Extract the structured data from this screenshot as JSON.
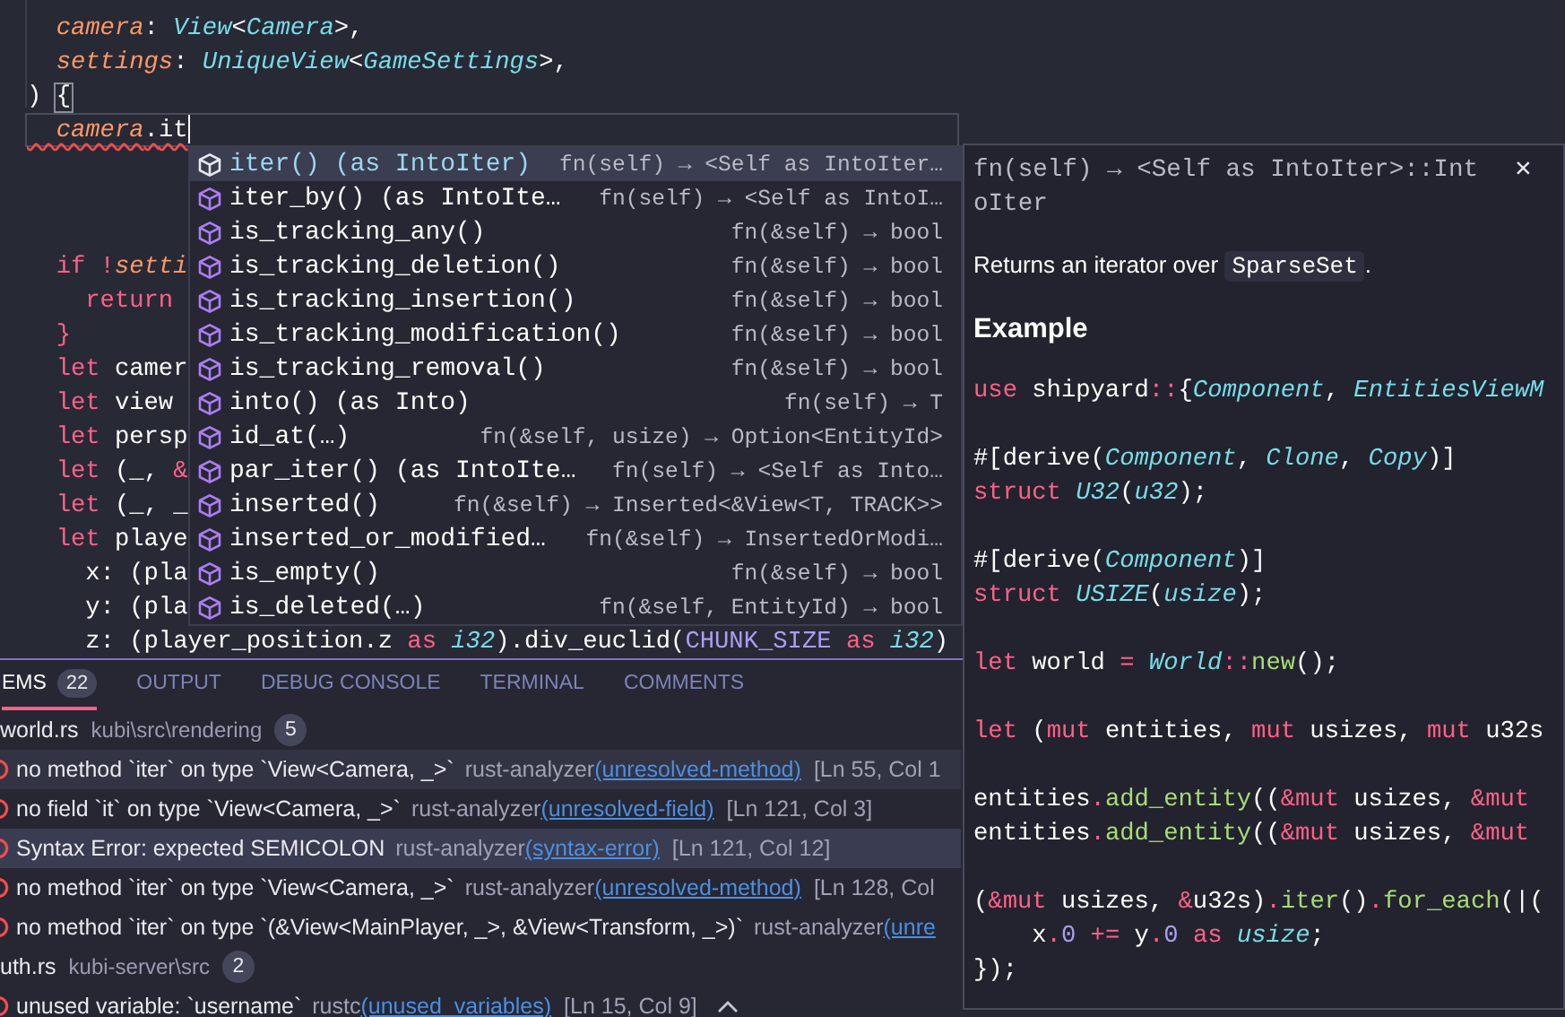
{
  "editor": {
    "lines_above": [
      {
        "current": false,
        "tokens": [
          {
            "kind": "var",
            "text": "  camera"
          },
          {
            "kind": "punct",
            "text": ": "
          },
          {
            "kind": "type",
            "text": "View"
          },
          {
            "kind": "punct",
            "text": "<"
          },
          {
            "kind": "type",
            "text": "Camera"
          },
          {
            "kind": "punct",
            "text": ">,"
          }
        ]
      },
      {
        "current": false,
        "tokens": [
          {
            "kind": "var",
            "text": "  settings"
          },
          {
            "kind": "punct",
            "text": ": "
          },
          {
            "kind": "type",
            "text": "UniqueView"
          },
          {
            "kind": "punct",
            "text": "<"
          },
          {
            "kind": "type",
            "text": "GameSettings"
          },
          {
            "kind": "punct",
            "text": ">,"
          }
        ]
      },
      {
        "current": false,
        "tokens": [
          {
            "kind": "plain",
            "text": ") "
          },
          {
            "kind": "bracket_match",
            "text": "{"
          }
        ]
      },
      {
        "current": true,
        "tokens": [
          {
            "kind": "var",
            "text": "  camera",
            "error": true
          },
          {
            "kind": "punct",
            "text": ".",
            "error": true
          },
          {
            "kind": "plain",
            "text": "it",
            "error": true
          }
        ]
      }
    ],
    "lines_below": [
      {
        "current": false,
        "tokens": [
          {
            "kind": "kw",
            "text": "  if !"
          },
          {
            "kind": "var",
            "text": "setti"
          }
        ]
      },
      {
        "current": false,
        "tokens": [
          {
            "kind": "kw",
            "text": "    return"
          }
        ]
      },
      {
        "current": false,
        "tokens": [
          {
            "kind": "kw",
            "text": "  }"
          }
        ]
      },
      {
        "current": false,
        "tokens": [
          {
            "kind": "kw",
            "text": "  let"
          },
          {
            "kind": "plain",
            "text": " camer"
          }
        ]
      },
      {
        "current": false,
        "tokens": [
          {
            "kind": "kw",
            "text": "  let"
          },
          {
            "kind": "plain",
            "text": " view"
          }
        ]
      },
      {
        "current": false,
        "tokens": [
          {
            "kind": "kw",
            "text": "  let"
          },
          {
            "kind": "plain",
            "text": " persp"
          }
        ]
      },
      {
        "current": false,
        "tokens": [
          {
            "kind": "kw",
            "text": "  let"
          },
          {
            "kind": "plain",
            "text": " (_, "
          },
          {
            "kind": "kw",
            "text": "&"
          }
        ]
      },
      {
        "current": false,
        "tokens": [
          {
            "kind": "kw",
            "text": "  let"
          },
          {
            "kind": "plain",
            "text": " (_, _"
          }
        ]
      },
      {
        "current": false,
        "tokens": [
          {
            "kind": "kw",
            "text": "  let"
          },
          {
            "kind": "plain",
            "text": " playe"
          }
        ]
      },
      {
        "current": false,
        "tokens": [
          {
            "kind": "plain",
            "text": "    x"
          },
          {
            "kind": "punct",
            "text": ": "
          },
          {
            "kind": "plain",
            "text": "(pla"
          }
        ]
      },
      {
        "current": false,
        "tokens": [
          {
            "kind": "plain",
            "text": "    y"
          },
          {
            "kind": "punct",
            "text": ": "
          },
          {
            "kind": "plain",
            "text": "(pla"
          }
        ]
      },
      {
        "current": false,
        "tokens": [
          {
            "kind": "plain",
            "text": "    z"
          },
          {
            "kind": "punct",
            "text": ": "
          },
          {
            "kind": "plain",
            "text": "(player_position"
          },
          {
            "kind": "punct",
            "text": "."
          },
          {
            "kind": "plain",
            "text": "z "
          },
          {
            "kind": "kw",
            "text": "as "
          },
          {
            "kind": "type",
            "text": "i32"
          },
          {
            "kind": "plain",
            "text": ")"
          },
          {
            "kind": "punct",
            "text": "."
          },
          {
            "kind": "plain",
            "text": "div_euclid("
          },
          {
            "kind": "const",
            "text": "CHUNK_SIZE"
          },
          {
            "kind": "kw",
            "text": " as "
          },
          {
            "kind": "type",
            "text": "i32"
          },
          {
            "kind": "plain",
            "text": ")"
          }
        ]
      }
    ]
  },
  "completions": [
    {
      "label": "iter() (as IntoIter)",
      "detail": "fn(self) → <Self as IntoIter…",
      "selected": true
    },
    {
      "label": "iter_by() (as IntoIte…",
      "detail": "fn(self) → <Self as IntoI…",
      "selected": false
    },
    {
      "label": "is_tracking_any()",
      "detail": "fn(&self) → bool",
      "selected": false
    },
    {
      "label": "is_tracking_deletion()",
      "detail": "fn(&self) → bool",
      "selected": false
    },
    {
      "label": "is_tracking_insertion()",
      "detail": "fn(&self) → bool",
      "selected": false
    },
    {
      "label": "is_tracking_modification()",
      "detail": "fn(&self) → bool",
      "selected": false
    },
    {
      "label": "is_tracking_removal()",
      "detail": "fn(&self) → bool",
      "selected": false
    },
    {
      "label": "into() (as Into)",
      "detail": "fn(self) → T",
      "selected": false
    },
    {
      "label": "id_at(…)",
      "detail": "fn(&self, usize) → Option<EntityId>",
      "selected": false
    },
    {
      "label": "par_iter() (as IntoIte…",
      "detail": "fn(self) → <Self as Into…",
      "selected": false
    },
    {
      "label": "inserted()",
      "detail": "fn(&self) → Inserted<&View<T, TRACK>>",
      "selected": false
    },
    {
      "label": "inserted_or_modified…",
      "detail": "fn(&self) → InsertedOrModi…",
      "selected": false
    },
    {
      "label": "is_empty()",
      "detail": "fn(&self) → bool",
      "selected": false
    },
    {
      "label": "is_deleted(…)",
      "detail": "fn(&self, EntityId) → bool",
      "selected": false
    }
  ],
  "doc": {
    "signature": "fn(self) → <Self as IntoIter>::IntoIter",
    "close": "×",
    "description": {
      "before": "Returns an iterator over",
      "code": "SparseSet",
      "after": "."
    },
    "heading": "Example",
    "code_blocks": [
      [
        [
          {
            "kind": "kw",
            "text": "use"
          },
          {
            "kind": "plain",
            "text": " shipyard"
          },
          {
            "kind": "kw",
            "text": "::"
          },
          {
            "kind": "plain",
            "text": "{"
          },
          {
            "kind": "type",
            "text": "Component"
          },
          {
            "kind": "plain",
            "text": ", "
          },
          {
            "kind": "type",
            "text": "EntitiesViewM"
          }
        ]
      ],
      [
        [
          {
            "kind": "plain",
            "text": "#[derive("
          },
          {
            "kind": "type",
            "text": "Component"
          },
          {
            "kind": "plain",
            "text": ", "
          },
          {
            "kind": "type",
            "text": "Clone"
          },
          {
            "kind": "plain",
            "text": ", "
          },
          {
            "kind": "type",
            "text": "Copy"
          },
          {
            "kind": "plain",
            "text": ")]"
          }
        ],
        [
          {
            "kind": "kw",
            "text": "struct "
          },
          {
            "kind": "type",
            "text": "U32"
          },
          {
            "kind": "plain",
            "text": "("
          },
          {
            "kind": "type",
            "text": "u32"
          },
          {
            "kind": "plain",
            "text": ");"
          }
        ]
      ],
      [
        [
          {
            "kind": "plain",
            "text": "#[derive("
          },
          {
            "kind": "type",
            "text": "Component"
          },
          {
            "kind": "plain",
            "text": ")]"
          }
        ],
        [
          {
            "kind": "kw",
            "text": "struct "
          },
          {
            "kind": "type",
            "text": "USIZE"
          },
          {
            "kind": "plain",
            "text": "("
          },
          {
            "kind": "type",
            "text": "usize"
          },
          {
            "kind": "plain",
            "text": ");"
          }
        ]
      ],
      [
        [
          {
            "kind": "kw",
            "text": "let"
          },
          {
            "kind": "plain",
            "text": " world "
          },
          {
            "kind": "kw",
            "text": "= "
          },
          {
            "kind": "type",
            "text": "World"
          },
          {
            "kind": "kw",
            "text": "::"
          },
          {
            "kind": "fn",
            "text": "new"
          },
          {
            "kind": "plain",
            "text": "();"
          }
        ]
      ],
      [
        [
          {
            "kind": "kw",
            "text": "let"
          },
          {
            "kind": "plain",
            "text": " ("
          },
          {
            "kind": "kw",
            "text": "mut"
          },
          {
            "kind": "plain",
            "text": " entities, "
          },
          {
            "kind": "kw",
            "text": "mut"
          },
          {
            "kind": "plain",
            "text": " usizes, "
          },
          {
            "kind": "kw",
            "text": "mut"
          },
          {
            "kind": "plain",
            "text": " u32s"
          }
        ]
      ],
      [
        [
          {
            "kind": "plain",
            "text": "entities"
          },
          {
            "kind": "kw",
            "text": "."
          },
          {
            "kind": "fn",
            "text": "add_entity"
          },
          {
            "kind": "plain",
            "text": "(("
          },
          {
            "kind": "kw",
            "text": "&mut"
          },
          {
            "kind": "plain",
            "text": " usizes, "
          },
          {
            "kind": "kw",
            "text": "&mut"
          }
        ],
        [
          {
            "kind": "plain",
            "text": "entities"
          },
          {
            "kind": "kw",
            "text": "."
          },
          {
            "kind": "fn",
            "text": "add_entity"
          },
          {
            "kind": "plain",
            "text": "(("
          },
          {
            "kind": "kw",
            "text": "&mut"
          },
          {
            "kind": "plain",
            "text": " usizes, "
          },
          {
            "kind": "kw",
            "text": "&mut"
          }
        ]
      ],
      [
        [
          {
            "kind": "plain",
            "text": "("
          },
          {
            "kind": "kw",
            "text": "&mut"
          },
          {
            "kind": "plain",
            "text": " usizes, "
          },
          {
            "kind": "kw",
            "text": "&"
          },
          {
            "kind": "plain",
            "text": "u32s)"
          },
          {
            "kind": "kw",
            "text": "."
          },
          {
            "kind": "fn",
            "text": "iter"
          },
          {
            "kind": "plain",
            "text": "()"
          },
          {
            "kind": "kw",
            "text": "."
          },
          {
            "kind": "fn",
            "text": "for_each"
          },
          {
            "kind": "plain",
            "text": "(|("
          }
        ],
        [
          {
            "kind": "plain",
            "text": "    x"
          },
          {
            "kind": "kw",
            "text": "."
          },
          {
            "kind": "num",
            "text": "0"
          },
          {
            "kind": "kw",
            "text": " += "
          },
          {
            "kind": "plain",
            "text": "y"
          },
          {
            "kind": "kw",
            "text": "."
          },
          {
            "kind": "num",
            "text": "0"
          },
          {
            "kind": "kw",
            "text": " as "
          },
          {
            "kind": "type",
            "text": "usize"
          },
          {
            "kind": "plain",
            "text": ";"
          }
        ],
        [
          {
            "kind": "plain",
            "text": "});"
          }
        ]
      ]
    ]
  },
  "panel": {
    "tabs": [
      {
        "label": "EMS",
        "badge": "22",
        "selected": true
      },
      {
        "label": "OUTPUT",
        "selected": false
      },
      {
        "label": "DEBUG CONSOLE",
        "selected": false
      },
      {
        "label": "TERMINAL",
        "selected": false
      },
      {
        "label": "COMMENTS",
        "selected": false
      }
    ],
    "groups": [
      {
        "file": "world.rs",
        "path": "kubi\\src\\rendering",
        "count": "5",
        "problems": [
          {
            "message": "no method `iter` on type `View<Camera, _>`",
            "source": "rust-analyzer",
            "code": "(unresolved-method)",
            "location": "[Ln 55, Col 1",
            "selected": false,
            "hovered": true
          },
          {
            "message": "no field `it` on type `View<Camera, _>`",
            "source": "rust-analyzer",
            "code": "(unresolved-field)",
            "location": "[Ln 121, Col 3]",
            "selected": false,
            "hovered": false
          },
          {
            "message": "Syntax Error: expected SEMICOLON",
            "source": "rust-analyzer",
            "code": "(syntax-error)",
            "location": "[Ln 121, Col 12]",
            "selected": true,
            "hovered": false
          },
          {
            "message": "no method `iter` on type `View<Camera, _>`",
            "source": "rust-analyzer",
            "code": "(unresolved-method)",
            "location": "[Ln 128, Col",
            "selected": false,
            "hovered": false
          },
          {
            "message": "no method `iter` on type `(&View<MainPlayer, _>, &View<Transform, _>)`",
            "source": "rust-analyzer",
            "code": "(unre",
            "selected": false,
            "hovered": false
          }
        ]
      },
      {
        "file": "uth.rs",
        "path": "kubi-server\\src",
        "count": "2",
        "problems": [
          {
            "message": "unused variable: `username`",
            "source": "rustc",
            "code": "(unused_variables)",
            "location": "[Ln 15, Col 9]",
            "selected": false,
            "hovered": false,
            "expanded": true
          }
        ]
      }
    ]
  }
}
